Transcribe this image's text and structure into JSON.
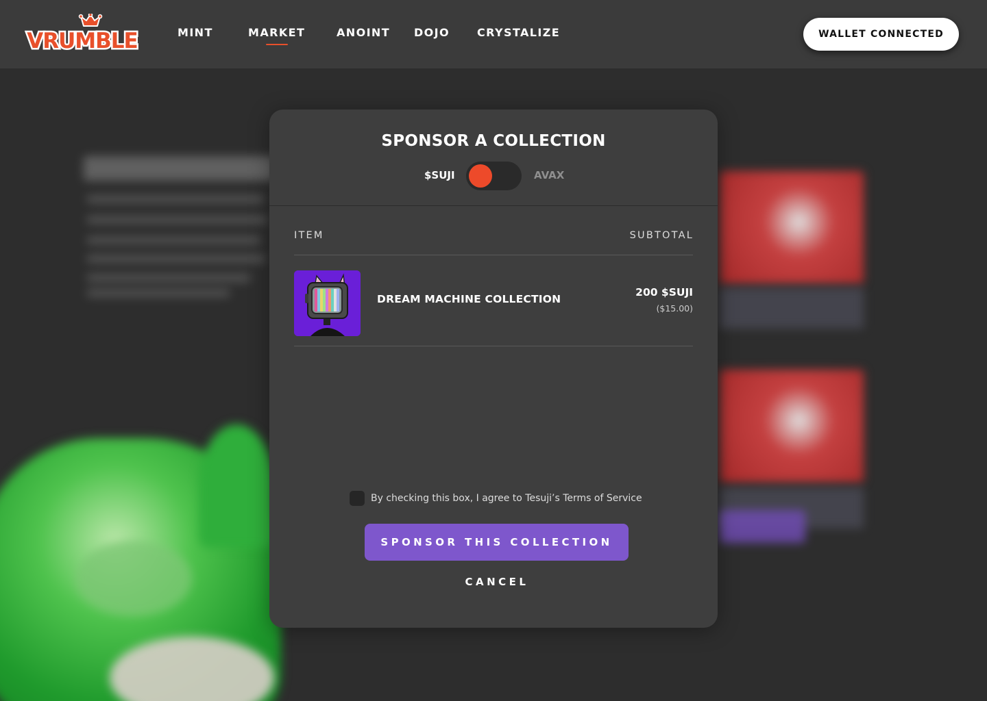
{
  "brand": {
    "logo_text": "VRUMBLE",
    "accent_color": "#e8502b"
  },
  "nav": {
    "items": [
      {
        "label": "MINT",
        "active": false
      },
      {
        "label": "MARKET",
        "active": true
      },
      {
        "label": "ANOINT",
        "active": false
      },
      {
        "label": "DOJO",
        "active": false
      },
      {
        "label": "CRYSTALIZE",
        "active": false
      }
    ],
    "wallet_button": "WALLET CONNECTED"
  },
  "modal": {
    "title": "SPONSOR A COLLECTION",
    "currency_toggle": {
      "left_label": "$SUJI",
      "right_label": "AVAX",
      "selected": "$SUJI",
      "knob_color": "#ed4a2a"
    },
    "table": {
      "headers": {
        "item": "ITEM",
        "subtotal": "SUBTOTAL"
      },
      "rows": [
        {
          "name": "DREAM MACHINE COLLECTION",
          "price": "200 $SUJI",
          "price_usd": "($15.00)",
          "thumbnail_icon": "tv-head-cat-icon"
        }
      ]
    },
    "terms": {
      "checked": false,
      "label": "By checking this box, I agree to Tesuji’s Terms of Service"
    },
    "primary_button": "SPONSOR THIS COLLECTION",
    "primary_color": "#7e57cc",
    "cancel_button": "CANCEL"
  }
}
